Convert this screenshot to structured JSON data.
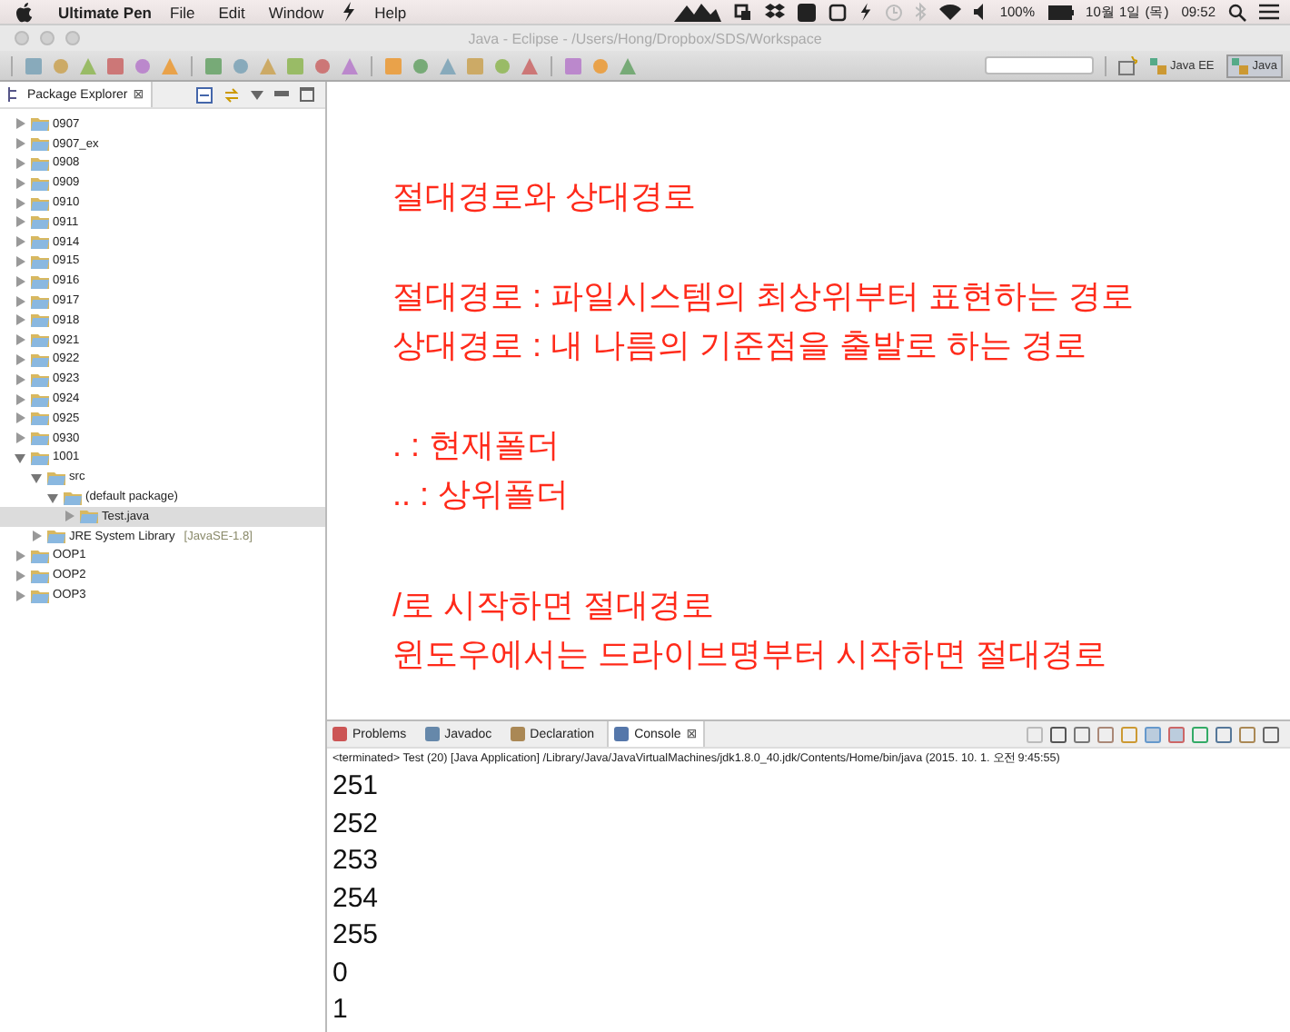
{
  "menu_bar": {
    "app_name": "Ultimate Pen",
    "items": [
      "File",
      "Edit",
      "Window",
      "Help"
    ],
    "battery": "100%",
    "date": "10월 1일 (목)",
    "time": "09:52"
  },
  "window": {
    "title": "Java - Eclipse - /Users/Hong/Dropbox/SDS/Workspace"
  },
  "toolbar": {
    "perspectives": [
      {
        "label": "Java EE",
        "selected": false
      },
      {
        "label": "Java",
        "selected": true
      }
    ]
  },
  "package_explorer": {
    "title": "Package Explorer",
    "close": "⊠",
    "items": [
      {
        "label": "0907",
        "expanded": false,
        "selected": false
      },
      {
        "label": "0907_ex",
        "expanded": false,
        "selected": false
      },
      {
        "label": "0908",
        "expanded": false,
        "selected": false
      },
      {
        "label": "0909",
        "expanded": false,
        "selected": false
      },
      {
        "label": "0910",
        "expanded": false,
        "selected": false
      },
      {
        "label": "0911",
        "expanded": false,
        "selected": false
      },
      {
        "label": "0914",
        "expanded": false,
        "selected": false
      },
      {
        "label": "0915",
        "expanded": false,
        "selected": false
      },
      {
        "label": "0916",
        "expanded": false,
        "selected": false
      },
      {
        "label": "0917",
        "expanded": false,
        "selected": false
      },
      {
        "label": "0918",
        "expanded": false,
        "selected": false
      },
      {
        "label": "0921",
        "expanded": false,
        "selected": false
      },
      {
        "label": "0922",
        "expanded": false,
        "selected": false
      },
      {
        "label": "0923",
        "expanded": false,
        "selected": false
      },
      {
        "label": "0924",
        "expanded": false,
        "selected": false
      },
      {
        "label": "0925",
        "expanded": false,
        "selected": false
      },
      {
        "label": "0930",
        "expanded": false,
        "selected": false
      },
      {
        "label": "1001",
        "expanded": true,
        "selected": false,
        "children": [
          {
            "label": "src",
            "expanded": true,
            "selected": false,
            "children": [
              {
                "label": "(default package)",
                "expanded": true,
                "selected": false,
                "children": [
                  {
                    "label": "Test.java",
                    "expanded": false,
                    "selected": true
                  }
                ]
              }
            ]
          },
          {
            "label": "JRE System Library",
            "suffix": "[JavaSE-1.8]",
            "expanded": false,
            "selected": false
          }
        ]
      },
      {
        "label": "OOP1",
        "expanded": false,
        "selected": false
      },
      {
        "label": "OOP2",
        "expanded": false,
        "selected": false
      },
      {
        "label": "OOP3",
        "expanded": false,
        "selected": false
      }
    ]
  },
  "editor": {
    "paragraphs": [
      [
        "절대경로와 상대경로"
      ],
      [
        "절대경로 : 파일시스템의 최상위부터 표현하는 경로",
        "상대경로 : 내 나름의 기준점을 출발로 하는 경로"
      ],
      [
        ". :  현재폴더",
        ".. : 상위폴더"
      ],
      [
        "/로 시작하면 절대경로",
        "윈도우에서는 드라이브명부터 시작하면 절대경로"
      ]
    ]
  },
  "bottom_panel": {
    "tabs": [
      {
        "label": "Problems",
        "selected": false
      },
      {
        "label": "Javadoc",
        "selected": false
      },
      {
        "label": "Declaration",
        "selected": false
      },
      {
        "label": "Console",
        "selected": true,
        "close": "⊠"
      }
    ],
    "status": "<terminated> Test (20) [Java Application] /Library/Java/JavaVirtualMachines/jdk1.8.0_40.jdk/Contents/Home/bin/java (2015. 10. 1. 오전 9:45:55)",
    "output": [
      "251",
      "252",
      "253",
      "254",
      "255",
      "0",
      "1"
    ]
  }
}
